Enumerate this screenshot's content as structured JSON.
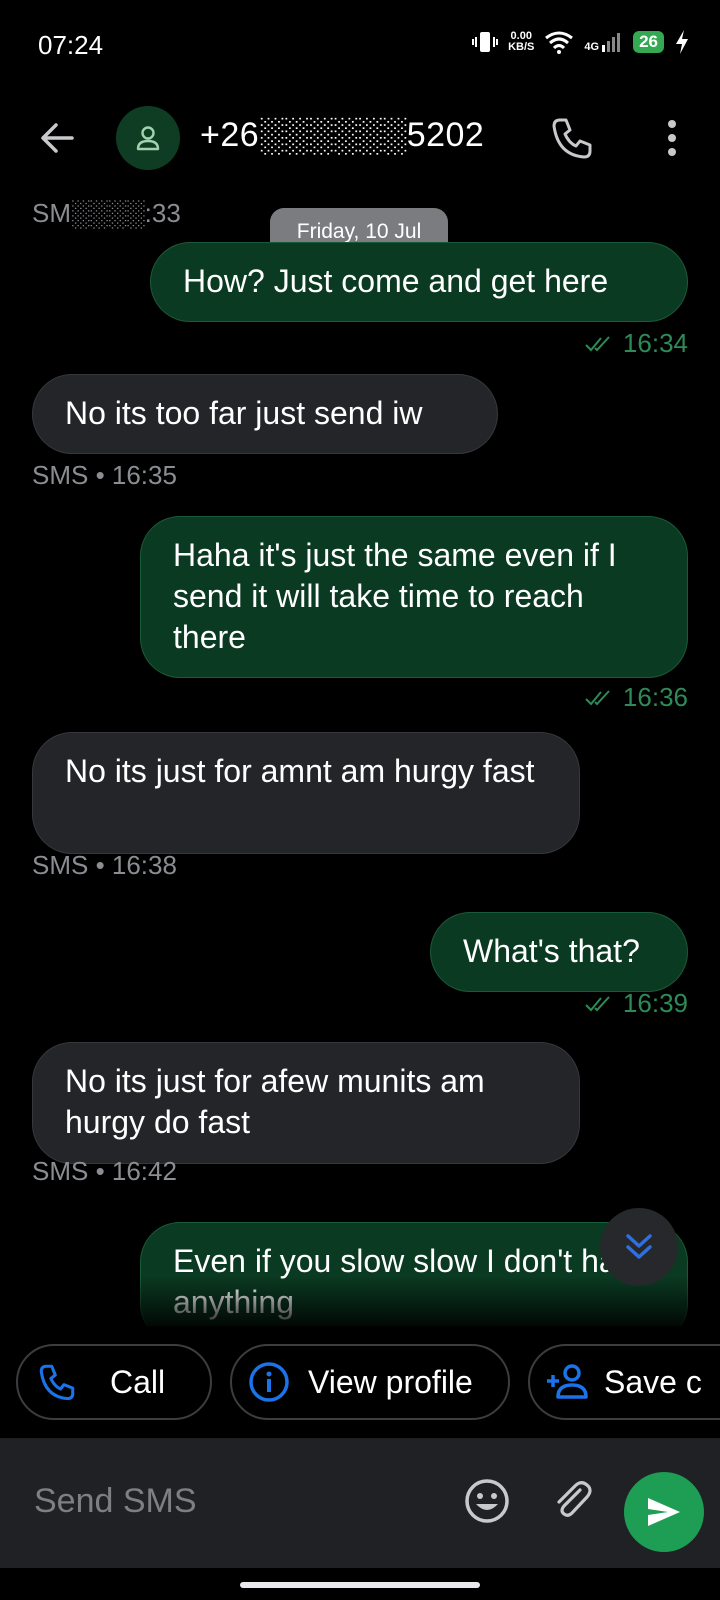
{
  "status_bar": {
    "time": "07:24",
    "net_speed_top": "0.00",
    "net_speed_bottom": "KB/S",
    "network_type": "4G",
    "battery": "26"
  },
  "header": {
    "contact": "+26░░░░░░5202"
  },
  "conversation": {
    "date_chip": "Friday, 10 Jul",
    "first_meta": "SM░░░░:33",
    "messages": [
      {
        "dir": "out",
        "text": "How? Just come and get here",
        "time": "16:34"
      },
      {
        "dir": "in",
        "text": "No its too far just send iw",
        "meta": "SMS • 16:35"
      },
      {
        "dir": "out",
        "text": "Haha it's just the same even if I send it will take time to reach there",
        "time": "16:36"
      },
      {
        "dir": "in",
        "text": "No its just for amnt am hurgy fast",
        "meta": "SMS • 16:38"
      },
      {
        "dir": "out",
        "text": "What's that?",
        "time": "16:39"
      },
      {
        "dir": "in",
        "text": "No its just for afew munits am hurgy do fast",
        "meta": "SMS • 16:42"
      },
      {
        "dir": "out",
        "text": "Even if you slow slow I don't have anything",
        "time": ""
      }
    ]
  },
  "quick_actions": {
    "call": "Call",
    "view_profile": "View profile",
    "save_contact": "Save c"
  },
  "composer": {
    "placeholder": "Send SMS"
  },
  "colors": {
    "outgoing_bubble": "#0b3a22",
    "incoming_bubble": "#242528",
    "send_button": "#1e9e55",
    "action_blue": "#1a73e8"
  }
}
